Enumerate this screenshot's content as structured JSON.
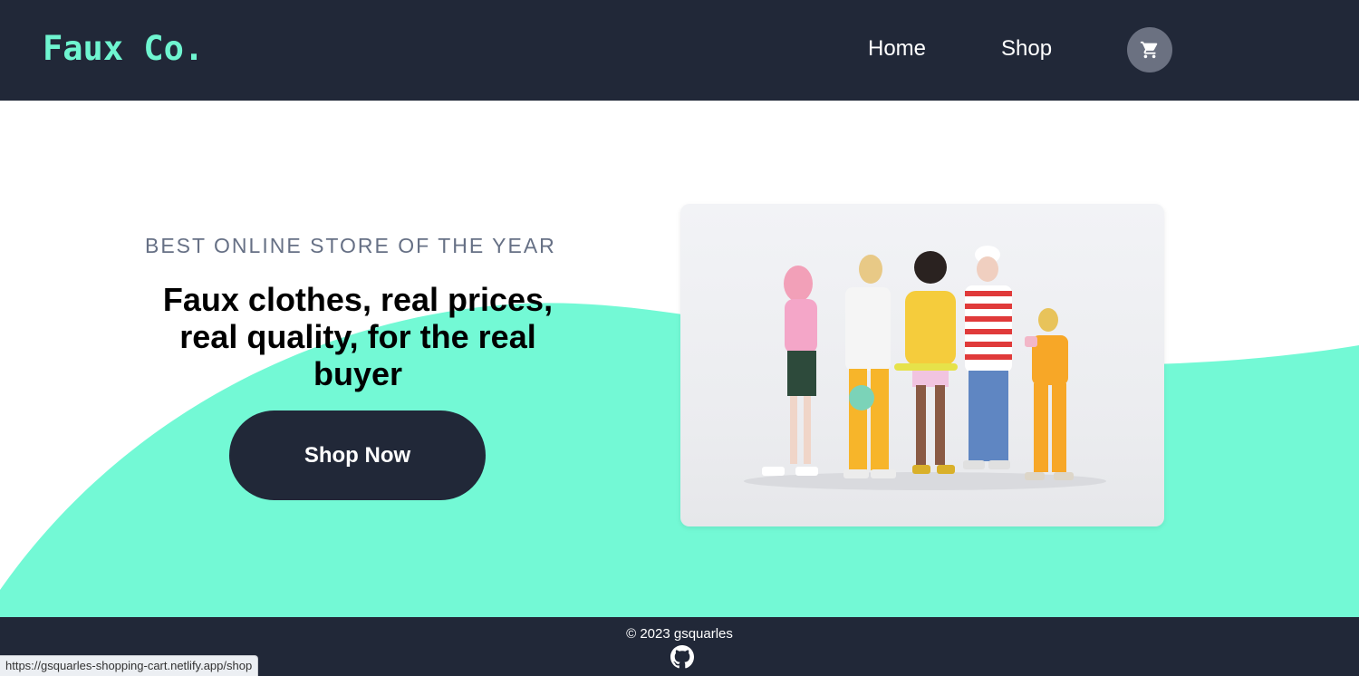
{
  "header": {
    "logo": "Faux Co.",
    "nav": {
      "home": "Home",
      "shop": "Shop"
    },
    "cart_icon": "cart-icon"
  },
  "hero": {
    "eyebrow": "BEST ONLINE STORE OF THE YEAR",
    "headline": "Faux clothes, real prices, real quality, for the real buyer",
    "cta": "Shop Now",
    "image_icon": "people-photo"
  },
  "footer": {
    "copyright": "© 2023 gsquarles",
    "github_icon": "github-icon"
  },
  "status_bar": {
    "url": "https://gsquarles-shopping-cart.netlify.app/shop"
  },
  "colors": {
    "nav_bg": "#212838",
    "accent": "#6ff5d0",
    "wave": "#73f9d5",
    "button": "#212838",
    "muted_text": "#667085"
  }
}
